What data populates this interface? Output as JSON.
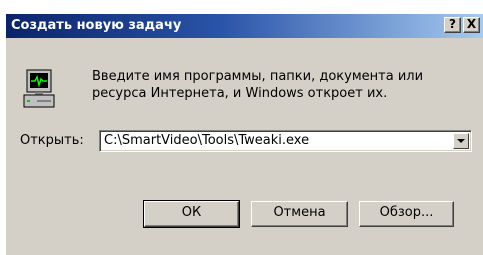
{
  "window": {
    "title": "Создать новую задачу",
    "help_label": "?",
    "close_label": "X"
  },
  "dialog": {
    "icon": "computer-monitor-icon",
    "message_line1": "Введите имя программы, папки, документа или",
    "message_line2": "ресурса Интернета, и Windows откроет их.",
    "open_label": "Открыть:",
    "open_value": "C:\\SmartVideo\\Tools\\Tweaki.exe"
  },
  "buttons": {
    "ok": "ОК",
    "cancel": "Отмена",
    "browse": "Обзор..."
  },
  "colors": {
    "titlebar_start": "#0a246a",
    "titlebar_end": "#a6caf0",
    "dialog_bg": "#d4d0c8"
  }
}
